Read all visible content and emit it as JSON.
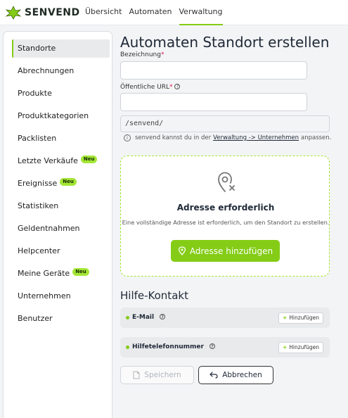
{
  "brand": {
    "name": "SENVEND",
    "accent": "#84cc16"
  },
  "nav": {
    "items": [
      {
        "label": "Übersicht"
      },
      {
        "label": "Automaten"
      },
      {
        "label": "Verwaltung",
        "active": true
      }
    ]
  },
  "sidebar": {
    "items": [
      {
        "label": "Standorte",
        "active": true
      },
      {
        "label": "Abrechnungen"
      },
      {
        "label": "Produkte"
      },
      {
        "label": "Produktkategorien"
      },
      {
        "label": "Packlisten"
      },
      {
        "label": "Letzte Verkäufe",
        "badge": "Neu"
      },
      {
        "label": "Ereignisse",
        "badge": "Neu"
      },
      {
        "label": "Statistiken"
      },
      {
        "label": "Geldentnahmen"
      },
      {
        "label": "Helpcenter"
      },
      {
        "label": "Meine Geräte",
        "badge": "Neu"
      },
      {
        "label": "Unternehmen"
      },
      {
        "label": "Benutzer"
      }
    ]
  },
  "form": {
    "title": "Automaten Standort erstellen",
    "name_label": "Bezeichnung",
    "name_required": "*",
    "name_value": "",
    "url_label": "Öffentliche URL",
    "url_required": "*",
    "url_value": "",
    "url_prefix": "/senvend/",
    "info_prefix": "senvend kannst du in der",
    "info_link": "Verwaltung -> Unternehmen",
    "info_suffix": "anpassen."
  },
  "address": {
    "title": "Adresse erforderlich",
    "text": "Eine vollständige Adresse ist erforderlich, um den Standort zu erstellen.",
    "button_label": "Adresse hinzufügen"
  },
  "help_contact": {
    "title": "Hilfe-Kontakt",
    "rows": [
      {
        "label": "E-Mail",
        "button": "Hinzufügen"
      },
      {
        "label": "Hilfetelefonnummer",
        "button": "Hinzufügen"
      }
    ]
  },
  "actions": {
    "save_label": "Speichern",
    "cancel_label": "Abbrechen"
  }
}
